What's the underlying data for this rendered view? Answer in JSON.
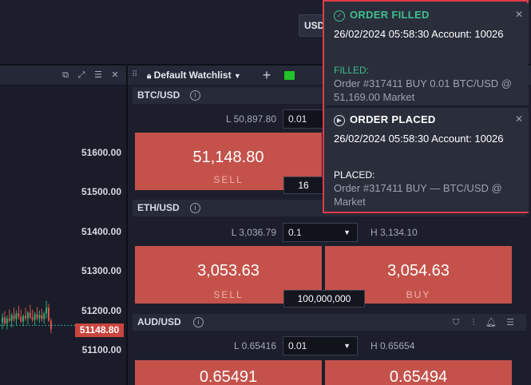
{
  "topbar": {
    "currency": "USD"
  },
  "chart": {
    "price_levels": [
      "51600.00",
      "51500.00",
      "51400.00",
      "51300.00",
      "51200.00",
      "51100.00"
    ],
    "current_price": "51148.80",
    "candles": [
      {
        "o": 51168,
        "h": 51190,
        "l": 51150,
        "c": 51180
      },
      {
        "o": 51180,
        "h": 51196,
        "l": 51160,
        "c": 51165
      },
      {
        "o": 51165,
        "h": 51185,
        "l": 51150,
        "c": 51178
      },
      {
        "o": 51178,
        "h": 51200,
        "l": 51168,
        "c": 51172
      },
      {
        "o": 51172,
        "h": 51192,
        "l": 51155,
        "c": 51186
      },
      {
        "o": 51186,
        "h": 51205,
        "l": 51170,
        "c": 51176
      },
      {
        "o": 51176,
        "h": 51198,
        "l": 51162,
        "c": 51190
      },
      {
        "o": 51190,
        "h": 51210,
        "l": 51175,
        "c": 51182
      },
      {
        "o": 51182,
        "h": 51200,
        "l": 51166,
        "c": 51170
      },
      {
        "o": 51170,
        "h": 51188,
        "l": 51158,
        "c": 51184
      },
      {
        "o": 51184,
        "h": 51205,
        "l": 51172,
        "c": 51178
      },
      {
        "o": 51178,
        "h": 51196,
        "l": 51162,
        "c": 51192
      },
      {
        "o": 51192,
        "h": 51212,
        "l": 51176,
        "c": 51180
      },
      {
        "o": 51180,
        "h": 51200,
        "l": 51168,
        "c": 51174
      },
      {
        "o": 51174,
        "h": 51194,
        "l": 51160,
        "c": 51188
      },
      {
        "o": 51188,
        "h": 51206,
        "l": 51172,
        "c": 51178
      },
      {
        "o": 51178,
        "h": 51198,
        "l": 51166,
        "c": 51186
      },
      {
        "o": 51186,
        "h": 51202,
        "l": 51170,
        "c": 51176
      },
      {
        "o": 51176,
        "h": 51195,
        "l": 51164,
        "c": 51190
      },
      {
        "o": 51190,
        "h": 51222,
        "l": 51178,
        "c": 51205
      },
      {
        "o": 51205,
        "h": 51215,
        "l": 51168,
        "c": 51172
      },
      {
        "o": 51172,
        "h": 51178,
        "l": 51140,
        "c": 51150
      }
    ]
  },
  "watchlist": {
    "title": "Default Watchlist",
    "instruments": [
      {
        "name": "BTC/USD",
        "low": "L 50,897.80",
        "qty": "0.01",
        "high": "",
        "sell_price": "51,148.80",
        "sell_label": "SELL",
        "buy_price": "",
        "buy_label": "",
        "volume": "16"
      },
      {
        "name": "ETH/USD",
        "low": "L 3,036.79",
        "qty": "0.1",
        "high": "H 3,134.10",
        "sell_price": "3,053.63",
        "sell_label": "SELL",
        "buy_price": "3,054.63",
        "buy_label": "BUY",
        "volume": "100,000,000"
      },
      {
        "name": "AUD/USD",
        "low": "L 0.65416",
        "qty": "0.01",
        "high": "H 0.65654",
        "sell_price": "0.65491",
        "sell_label": "",
        "buy_price": "0.65494",
        "buy_label": "",
        "volume": ""
      }
    ]
  },
  "notifications": [
    {
      "title": "ORDER FILLED",
      "title_color": "#3fbf8e",
      "body": "26/02/2024 05:58:30 Account: 10026",
      "status": "FILLED:",
      "status_color": "#3fbf8e",
      "detail": "Order #317411 BUY 0.01 BTC/USD @ 51,169.00 Market"
    },
    {
      "title": "ORDER PLACED",
      "title_color": "#ffffff",
      "body": "26/02/2024 05:58:30 Account: 10026",
      "status": "PLACED:",
      "status_color": "#ffffff",
      "detail": "Order #317411 BUY — BTC/USD @ Market"
    }
  ],
  "colors": {
    "sell": "#c4524b",
    "accent_green": "#22c328",
    "alert_border": "#e03c4a"
  }
}
